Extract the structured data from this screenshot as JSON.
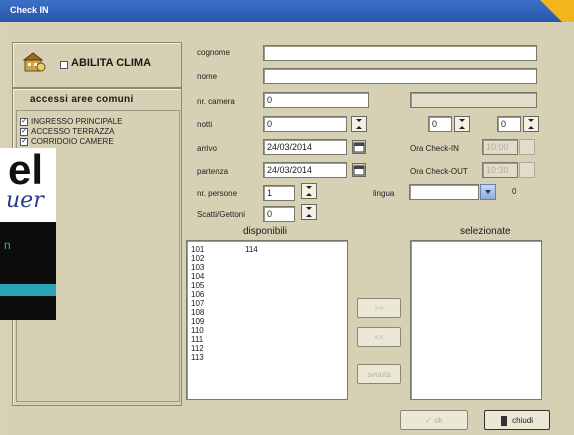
{
  "window": {
    "title": "Check IN"
  },
  "clima": {
    "label": "ABILITA CLIMA",
    "checked": false
  },
  "aree": {
    "heading": "accessi aree comuni",
    "items": [
      {
        "label": "INGRESSO PRINCIPALE",
        "checked": true
      },
      {
        "label": "ACCESSO TERRAZZA",
        "checked": true
      },
      {
        "label": "CORRIDOIO CAMERE",
        "checked": true
      }
    ]
  },
  "logo": {
    "text_top": "el",
    "text_script": "uer",
    "text_small": "n"
  },
  "form": {
    "cognome": {
      "label": "cognome",
      "value": ""
    },
    "nome": {
      "label": "nome",
      "value": ""
    },
    "camera": {
      "label": "nr. camera",
      "value": "0"
    },
    "notti": {
      "label": "notti",
      "value": "0"
    },
    "arrivo": {
      "label": "arrivo",
      "value": "24/03/2014"
    },
    "partenza": {
      "label": "partenza",
      "value": "24/03/2014"
    },
    "persone": {
      "label": "nr. persone",
      "value": "1"
    },
    "scatti": {
      "label": "Scatti/Gettoni",
      "value": "0"
    },
    "lingua": {
      "label": "lingua",
      "value": ""
    },
    "extra1": "0",
    "extra2": "0",
    "ora_checkin": {
      "label": "Ora Check-IN",
      "value": "10:00"
    },
    "ora_checkout": {
      "label": "Ora Check-OUT",
      "value": "10:30"
    },
    "lingua_code": "0"
  },
  "disponibili": {
    "heading": "disponibili",
    "col1": [
      "101",
      "102",
      "103",
      "104",
      "105",
      "106",
      "107",
      "108",
      "109",
      "110",
      "111",
      "112",
      "113"
    ],
    "col2": [
      "114"
    ]
  },
  "selezionate": {
    "heading": "selezionate",
    "items": []
  },
  "buttons": {
    "add": ">>",
    "remove": "<<",
    "svuota": "svuota",
    "ok": "ok",
    "chiudi": "chiudi"
  }
}
